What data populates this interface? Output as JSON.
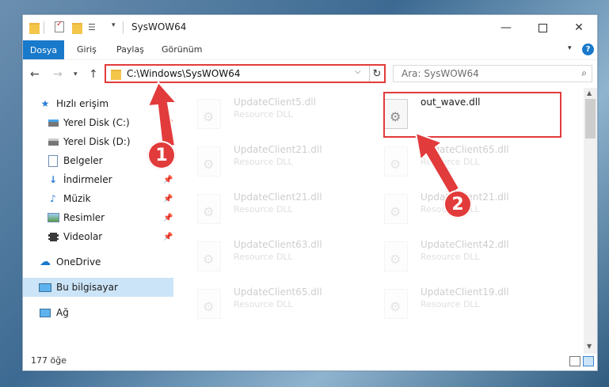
{
  "window": {
    "title": "SysWOW64",
    "minimize_icon": "minimize-icon",
    "maximize_icon": "maximize-icon",
    "close_icon": "close-icon"
  },
  "ribbon": {
    "tabs": [
      "Dosya",
      "Giriş",
      "Paylaş",
      "Görünüm"
    ],
    "expand_icon": "chevron-down-icon",
    "help_icon": "help-icon",
    "help_label": "?"
  },
  "navigation": {
    "back_icon": "back-arrow-icon",
    "forward_icon": "forward-arrow-icon",
    "recent_icon": "chevron-down-icon",
    "up_icon": "up-arrow-icon",
    "address": "C:\\Windows\\SysWOW64",
    "search_placeholder": "Ara: SysWOW64"
  },
  "sidebar": {
    "items": [
      {
        "label": "Hızlı erişim",
        "icon": "star-icon",
        "pinned": false
      },
      {
        "label": "Yerel Disk (C:)",
        "icon": "drive-icon",
        "pinned": true
      },
      {
        "label": "Yerel Disk (D:)",
        "icon": "drive-icon",
        "pinned": true
      },
      {
        "label": "Belgeler",
        "icon": "document-icon",
        "pinned": true
      },
      {
        "label": "İndirmeler",
        "icon": "download-icon",
        "pinned": true
      },
      {
        "label": "Müzik",
        "icon": "music-icon",
        "pinned": true
      },
      {
        "label": "Resimler",
        "icon": "picture-icon",
        "pinned": true
      },
      {
        "label": "Videolar",
        "icon": "video-icon",
        "pinned": true
      },
      {
        "label": "OneDrive",
        "icon": "cloud-icon",
        "pinned": false
      },
      {
        "label": "Bu bilgisayar",
        "icon": "computer-icon",
        "pinned": false,
        "selected": true
      },
      {
        "label": "Ağ",
        "icon": "network-icon",
        "pinned": false
      }
    ]
  },
  "files": [
    {
      "name": "UpdateClient5.dll",
      "type": "Resource DLL",
      "faded": true
    },
    {
      "name": "out_wave.dll",
      "type": "",
      "faded": false,
      "highlighted": true
    },
    {
      "name": "UpdateClient21.dll",
      "type": "Resource DLL",
      "faded": true
    },
    {
      "name": "UpdateClient65.dll",
      "type": "Resource DLL",
      "faded": true
    },
    {
      "name": "UpdateClient21.dll",
      "type": "Resource DLL",
      "faded": true
    },
    {
      "name": "UpdateClient21.dll",
      "type": "Resource DLL",
      "faded": true
    },
    {
      "name": "UpdateClient63.dll",
      "type": "Resource DLL",
      "faded": true
    },
    {
      "name": "UpdateClient42.dll",
      "type": "Resource DLL",
      "faded": true
    },
    {
      "name": "UpdateClient65.dll",
      "type": "Resource DLL",
      "faded": true
    },
    {
      "name": "UpdateClient19.dll",
      "type": "Resource DLL",
      "faded": true
    }
  ],
  "status": {
    "item_count": "177 öğe"
  },
  "annotations": {
    "step1": "1",
    "step2": "2",
    "color": "#e23b3b"
  },
  "colors": {
    "accent": "#1979ca",
    "selection": "#cce4f7",
    "highlight": "#e23b3b"
  }
}
